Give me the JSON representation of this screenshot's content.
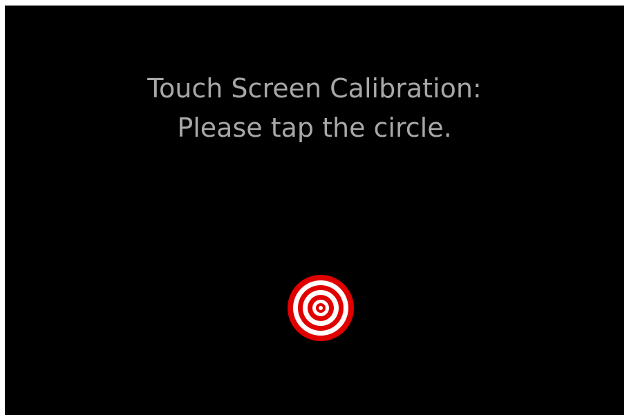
{
  "screen": {
    "title_line": "Touch Screen Calibration:",
    "prompt_line": "Please tap the circle."
  },
  "colors": {
    "background": "#000000",
    "text": "#a8a8a8",
    "target_red": "#e00000",
    "target_white": "#ffffff"
  },
  "target": {
    "icon": "bullseye-target-icon"
  }
}
